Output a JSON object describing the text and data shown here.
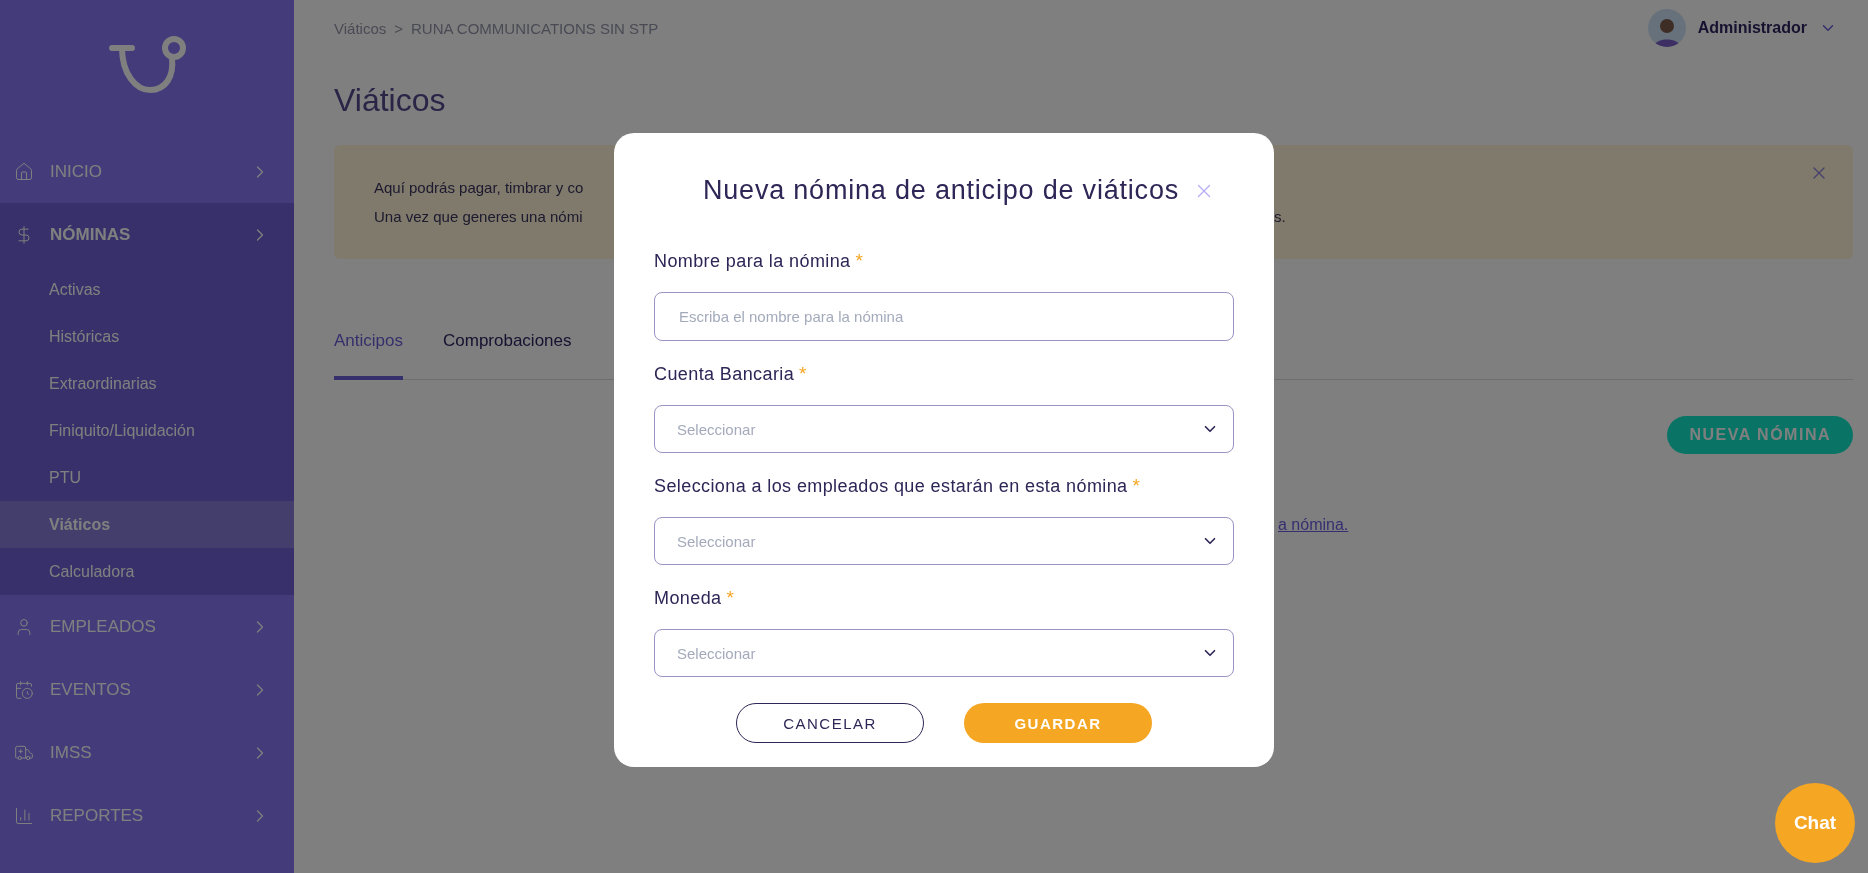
{
  "sidebar": {
    "items": [
      {
        "label": "INICIO",
        "expanded": false
      },
      {
        "label": "NÓMINAS",
        "expanded": true,
        "children": [
          {
            "label": "Activas",
            "selected": false
          },
          {
            "label": "Históricas",
            "selected": false
          },
          {
            "label": "Extraordinarias",
            "selected": false
          },
          {
            "label": "Finiquito/Liquidación",
            "selected": false
          },
          {
            "label": "PTU",
            "selected": false
          },
          {
            "label": "Viáticos",
            "selected": true
          },
          {
            "label": "Calculadora",
            "selected": false
          }
        ]
      },
      {
        "label": "EMPLEADOS",
        "expanded": false
      },
      {
        "label": "EVENTOS",
        "expanded": false
      },
      {
        "label": "IMSS",
        "expanded": false
      },
      {
        "label": "REPORTES",
        "expanded": false
      }
    ]
  },
  "header": {
    "breadcrumb": [
      "Viáticos",
      "RUNA COMMUNICATIONS SIN STP"
    ],
    "separator": ">",
    "user": "Administrador"
  },
  "page_title": "Viáticos",
  "notice": {
    "lines": [
      {
        "left": "Aquí podrás pagar, timbrar y co"
      },
      {
        "left": "Una vez que generes una nómi",
        "right": "s."
      }
    ]
  },
  "tabs": [
    {
      "label": "Anticipos",
      "selected": true
    },
    {
      "label": "Comprobaciones",
      "selected": false
    }
  ],
  "new_button": "NUEVA NÓMINA",
  "empty_link": "a nómina.",
  "modal": {
    "title": "Nueva nómina de anticipo de viáticos",
    "fields": [
      {
        "kind": "text",
        "label": "Nombre para la nómina",
        "required_mark": "*",
        "placeholder": "Escriba el nombre para la nómina"
      },
      {
        "kind": "select",
        "label": "Cuenta Bancaria",
        "required_mark": "*",
        "placeholder": "Seleccionar"
      },
      {
        "kind": "select",
        "label": "Selecciona a los empleados que estarán en esta nómina",
        "required_mark": "*",
        "placeholder": "Seleccionar"
      },
      {
        "kind": "select",
        "label": "Moneda",
        "required_mark": "*",
        "placeholder": "Seleccionar"
      }
    ],
    "cancel": "CANCELAR",
    "save": "GUARDAR"
  },
  "chat": "Chat"
}
